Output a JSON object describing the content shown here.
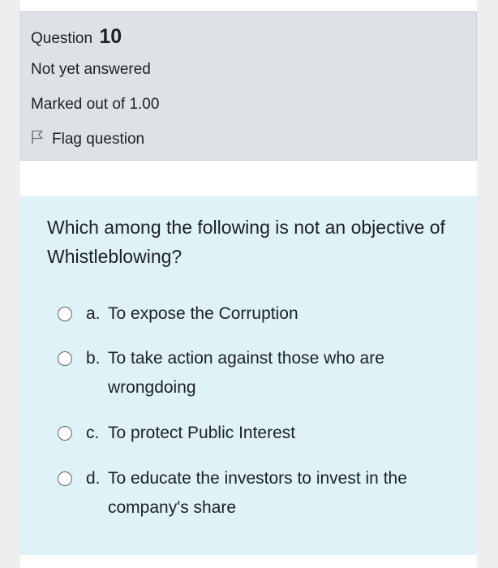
{
  "question": {
    "title_prefix": "Question",
    "number": "10",
    "state": "Not yet answered",
    "grade": "Marked out of 1.00",
    "flag_label": "Flag question"
  },
  "icons": {
    "flag": "flag-outline-icon",
    "radio": "radio-unchecked-icon"
  },
  "colors": {
    "info_background": "#dee2e6",
    "formulation_background": "#def2f8"
  },
  "formulation": {
    "text": "Which among the following is not an objective of Whistleblowing?",
    "answers": [
      {
        "letter": "a.",
        "text": "To expose the Corruption",
        "selected": false
      },
      {
        "letter": "b.",
        "text": "To take action against those who are wrongdoing",
        "selected": false
      },
      {
        "letter": "c.",
        "text": "To protect Public Interest",
        "selected": false
      },
      {
        "letter": "d.",
        "text": "To educate the investors to invest in the company's share",
        "selected": false
      }
    ]
  }
}
